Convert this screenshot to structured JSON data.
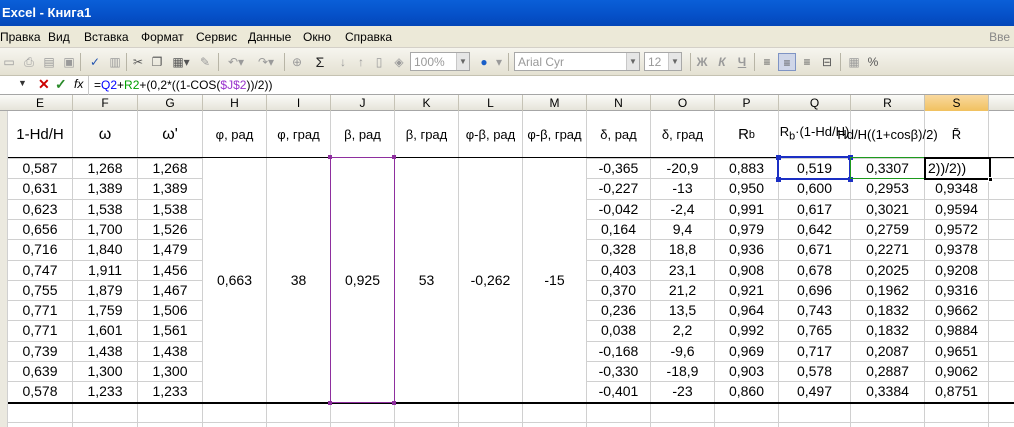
{
  "window": {
    "title": "Excel - Книга1"
  },
  "menu": {
    "items": [
      "Правка",
      "Вид",
      "Вставка",
      "Формат",
      "Сервис",
      "Данные",
      "Окно",
      "Справка"
    ],
    "help_prompt": "Вве"
  },
  "toolbar": {
    "zoom": "100%",
    "font": "Arial Cyr",
    "font_size": "12",
    "bold": "Ж",
    "italic": "К",
    "underline": "Ч",
    "percent": "%",
    "sum": "Σ"
  },
  "formula_bar": {
    "fx": "fx",
    "formula_parts": [
      "=",
      "Q2",
      "+",
      "R2",
      "+(0,2*((1-COS(",
      "$J$2",
      "))/2))"
    ]
  },
  "columns": [
    "E",
    "F",
    "G",
    "H",
    "I",
    "J",
    "K",
    "L",
    "M",
    "N",
    "O",
    "P",
    "Q",
    "R",
    "S"
  ],
  "headers": {
    "E": "1-Hd/H",
    "F": "ω",
    "G": "ω'",
    "H": "φ, рад",
    "I": "φ, град",
    "J": "β, рад",
    "K": "β, град",
    "L": "φ-β, рад",
    "M": "φ-β, град",
    "N": "δ, рад",
    "O": "δ, град",
    "P_main": "R",
    "P_sub": "b",
    "Q_main": "R",
    "Q_sub": "b",
    "Q_rest": "·(1-Hd/H)",
    "R": "Hd/H((1+cosβ)/2)",
    "S": "R̃"
  },
  "merged_values": {
    "H": "0,663",
    "I": "38",
    "J": "0,925",
    "K": "53",
    "L": "-0,262",
    "M": "-15"
  },
  "active_cell": {
    "text": "\u0002))/2))"
  },
  "rows": [
    {
      "E": "0,587",
      "F": "1,268",
      "G": "1,268",
      "N": "-0,365",
      "O": "-20,9",
      "P": "0,883",
      "Q": "0,519",
      "R": "0,3307",
      "S": "2))/2))"
    },
    {
      "E": "0,631",
      "F": "1,389",
      "G": "1,389",
      "N": "-0,227",
      "O": "-13",
      "P": "0,950",
      "Q": "0,600",
      "R": "0,2953",
      "S": "0,9348"
    },
    {
      "E": "0,623",
      "F": "1,538",
      "G": "1,538",
      "N": "-0,042",
      "O": "-2,4",
      "P": "0,991",
      "Q": "0,617",
      "R": "0,3021",
      "S": "0,9594"
    },
    {
      "E": "0,656",
      "F": "1,700",
      "G": "1,526",
      "N": "0,164",
      "O": "9,4",
      "P": "0,979",
      "Q": "0,642",
      "R": "0,2759",
      "S": "0,9572"
    },
    {
      "E": "0,716",
      "F": "1,840",
      "G": "1,479",
      "N": "0,328",
      "O": "18,8",
      "P": "0,936",
      "Q": "0,671",
      "R": "0,2271",
      "S": "0,9378"
    },
    {
      "E": "0,747",
      "F": "1,911",
      "G": "1,456",
      "N": "0,403",
      "O": "23,1",
      "P": "0,908",
      "Q": "0,678",
      "R": "0,2025",
      "S": "0,9208"
    },
    {
      "E": "0,755",
      "F": "1,879",
      "G": "1,467",
      "N": "0,370",
      "O": "21,2",
      "P": "0,921",
      "Q": "0,696",
      "R": "0,1962",
      "S": "0,9316"
    },
    {
      "E": "0,771",
      "F": "1,759",
      "G": "1,506",
      "N": "0,236",
      "O": "13,5",
      "P": "0,964",
      "Q": "0,743",
      "R": "0,1832",
      "S": "0,9662"
    },
    {
      "E": "0,771",
      "F": "1,601",
      "G": "1,561",
      "N": "0,038",
      "O": "2,2",
      "P": "0,992",
      "Q": "0,765",
      "R": "0,1832",
      "S": "0,9884"
    },
    {
      "E": "0,739",
      "F": "1,438",
      "G": "1,438",
      "N": "-0,168",
      "O": "-9,6",
      "P": "0,969",
      "Q": "0,717",
      "R": "0,2087",
      "S": "0,9651"
    },
    {
      "E": "0,639",
      "F": "1,300",
      "G": "1,300",
      "N": "-0,330",
      "O": "-18,9",
      "P": "0,903",
      "Q": "0,578",
      "R": "0,2887",
      "S": "0,9062"
    },
    {
      "E": "0,578",
      "F": "1,233",
      "G": "1,233",
      "N": "-0,401",
      "O": "-23",
      "P": "0,860",
      "Q": "0,497",
      "R": "0,3384",
      "S": "0,8751"
    }
  ]
}
